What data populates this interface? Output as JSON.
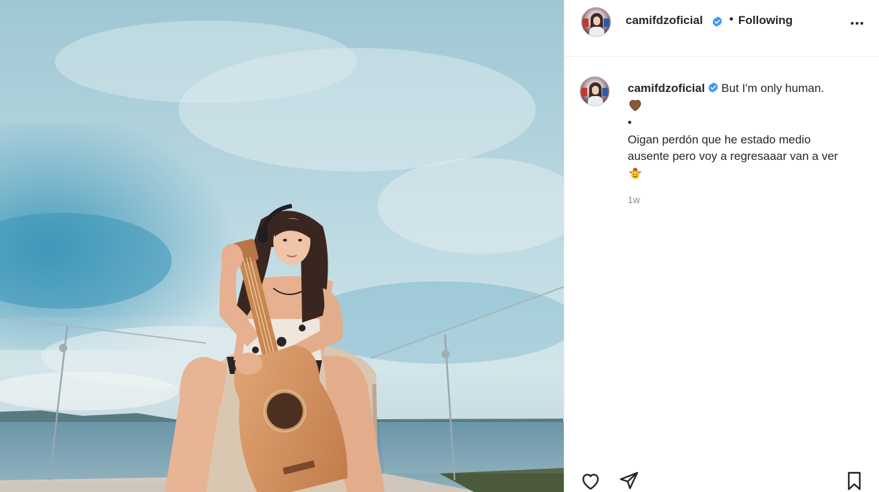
{
  "post": {
    "username": "camifdzoficial",
    "verified": true,
    "follow_separator": "•",
    "follow_status": "Following",
    "more_label": "More options"
  },
  "caption": {
    "username": "camifdzoficial",
    "line1": "But I'm only human.",
    "emoji1": "brown-heart-emoji",
    "bullet": "•",
    "line2": "Oigan perdón que he estado medio ausente pero voy a regresaaar van a ver",
    "emoji2": "cowboy-face-emoji",
    "timestamp": "1w"
  },
  "actions": {
    "like_icon": "heart-icon",
    "share_icon": "paper-plane-icon",
    "save_icon": "bookmark-icon"
  },
  "colors": {
    "text": "#262626",
    "secondary": "#8e8e8e",
    "verified": "#3897f0",
    "divider": "#efefef"
  }
}
